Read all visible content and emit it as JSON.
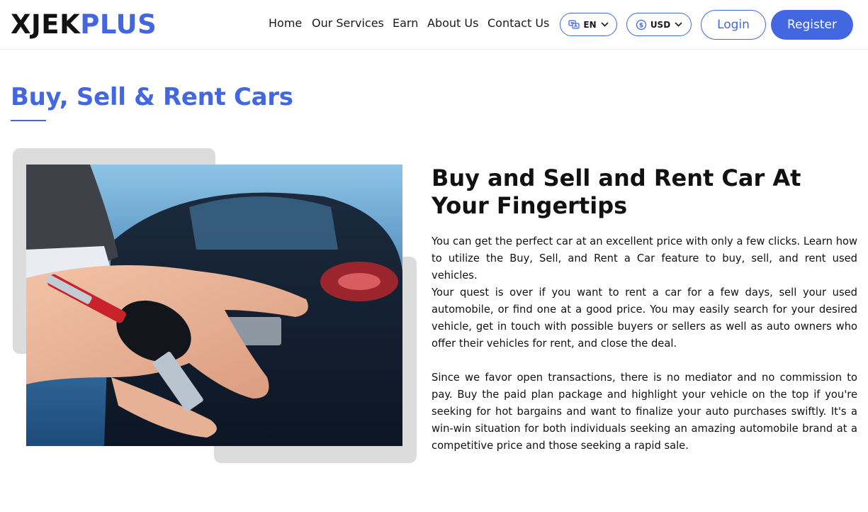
{
  "logo": {
    "part1": "XJEK",
    "part2": "PLUS"
  },
  "nav": {
    "home": "Home",
    "services": "Our Services",
    "earn": "Earn",
    "about": "About Us",
    "contact": "Contact Us"
  },
  "language": {
    "selected": "EN",
    "icon": "language-icon"
  },
  "currency": {
    "selected": "USD",
    "icon": "currency-icon"
  },
  "auth": {
    "login": "Login",
    "register": "Register"
  },
  "page": {
    "title": "Buy, Sell & Rent Cars",
    "heading": "Buy and Sell and Rent Car At Your Fingertips",
    "paragraph1": "You can get the perfect car at an excellent price with only a few clicks. Learn how to utilize the Buy, Sell, and Rent a Car feature to buy, sell, and rent used vehicles.",
    "paragraph2": "Your quest is over if you want to rent a car for a few days, sell your used automobile, or find one at a good price. You may easily search for your desired vehicle, get in touch with possible buyers or sellers as well as auto owners who offer their vehicles for rent, and close the deal.",
    "paragraph3": "Since we favor open transactions, there is no mediator and no commission to pay. Buy the paid plan package and highlight your vehicle on the top if you're seeking for hot bargains and want to finalize your auto purchases swiftly. It's a win-win situation for both individuals seeking an amazing automobile brand at a competitive price and those seeking a rapid sale."
  },
  "colors": {
    "accent": "#4267e0",
    "text": "#111111",
    "panel": "#dcdcdc"
  }
}
